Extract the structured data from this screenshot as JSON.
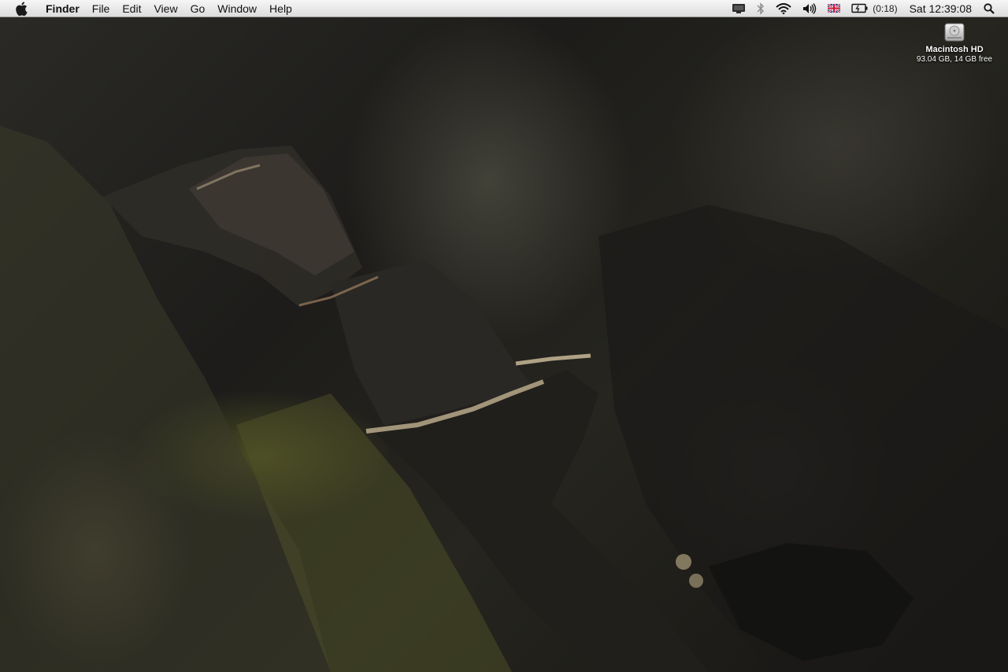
{
  "menubar": {
    "app_name": "Finder",
    "menus": [
      "File",
      "Edit",
      "View",
      "Go",
      "Window",
      "Help"
    ],
    "status": {
      "battery_time": "(0:18)",
      "clock": "Sat 12:39:08",
      "input_source": "British"
    },
    "icons": [
      "apple-icon",
      "display-icon",
      "bluetooth-icon",
      "wifi-icon",
      "volume-icon",
      "flag-uk-icon",
      "battery-icon",
      "spotlight-icon"
    ]
  },
  "desktop": {
    "drive": {
      "name": "Macintosh HD",
      "info": "93.04 GB, 14 GB free"
    }
  }
}
